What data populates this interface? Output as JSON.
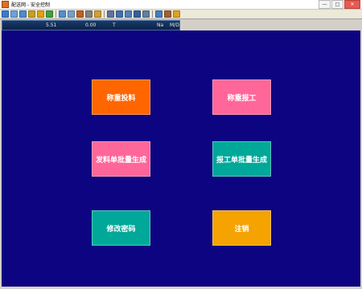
{
  "window": {
    "title": "配送网 - 安全控制",
    "controls": [
      "—",
      "□",
      "✕"
    ]
  },
  "toolbar": {
    "icons": [
      {
        "name": "cut-icon",
        "color": "#3a7ad4"
      },
      {
        "name": "copy-icon",
        "color": "#6aa0e0"
      },
      {
        "name": "paste-icon",
        "color": "#4a8ad0"
      },
      {
        "name": "edit-icon",
        "color": "#c8a020"
      },
      {
        "name": "star-icon",
        "color": "#e0a010"
      },
      {
        "name": "link-icon",
        "color": "#40a040"
      },
      {
        "name": "people-icon",
        "color": "#5090d0"
      },
      {
        "name": "message-icon",
        "color": "#70a0d0"
      },
      {
        "name": "user-icon",
        "color": "#c06020"
      },
      {
        "name": "print-icon",
        "color": "#808080"
      },
      {
        "name": "lock-icon",
        "color": "#d0a030"
      },
      {
        "name": "settings-icon",
        "color": "#6070a0"
      },
      {
        "name": "window-icon",
        "color": "#4070b0"
      },
      {
        "name": "cascade-icon",
        "color": "#5080c0"
      },
      {
        "name": "grid-icon",
        "color": "#3060a0"
      },
      {
        "name": "calc-icon",
        "color": "#6080a0"
      },
      {
        "name": "chart-icon",
        "color": "#4080c0"
      },
      {
        "name": "tools-icon",
        "color": "#a06030"
      },
      {
        "name": "exit-icon",
        "color": "#e0a020"
      }
    ]
  },
  "status": {
    "weight": "5.51",
    "tare": "0.00",
    "unit": "T",
    "field_a": "Na",
    "field_b": "M/D"
  },
  "buttons": [
    {
      "label": "称重投料",
      "color": "#ff6600"
    },
    {
      "label": "称重报工",
      "color": "#ff6699"
    },
    {
      "label": "发料单批量生成",
      "color": "#ff6699"
    },
    {
      "label": "报工单批量生成",
      "color": "#00a89a"
    },
    {
      "label": "修改密码",
      "color": "#00a89a"
    },
    {
      "label": "注销",
      "color": "#f4a300"
    }
  ]
}
